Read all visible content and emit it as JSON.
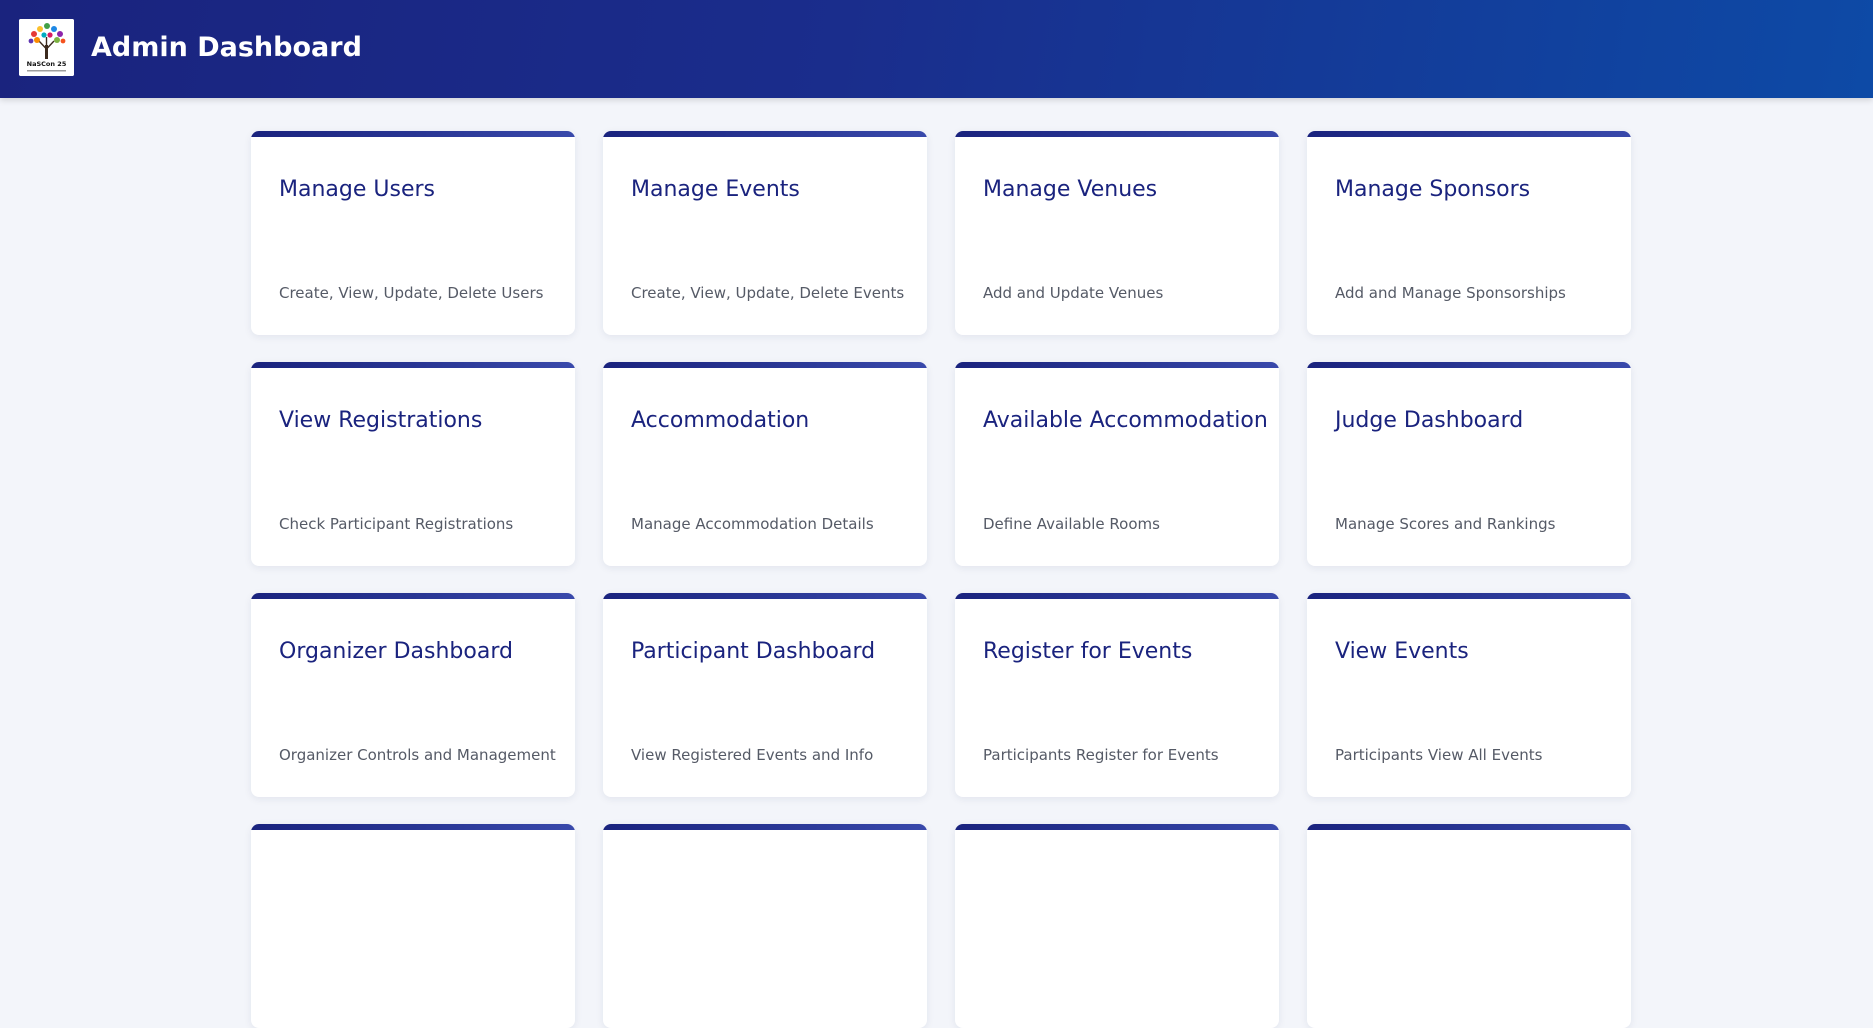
{
  "header": {
    "title": "Admin Dashboard",
    "logo_text": "NaSCon 25"
  },
  "cards": [
    {
      "title": "Manage Users",
      "description": "Create, View, Update, Delete Users"
    },
    {
      "title": "Manage Events",
      "description": "Create, View, Update, Delete Events"
    },
    {
      "title": "Manage Venues",
      "description": "Add and Update Venues"
    },
    {
      "title": "Manage Sponsors",
      "description": "Add and Manage Sponsorships"
    },
    {
      "title": "View Registrations",
      "description": "Check Participant Registrations"
    },
    {
      "title": "Accommodation",
      "description": "Manage Accommodation Details"
    },
    {
      "title": "Available Accommodation",
      "description": "Define Available Rooms"
    },
    {
      "title": "Judge Dashboard",
      "description": "Manage Scores and Rankings"
    },
    {
      "title": "Organizer Dashboard",
      "description": "Organizer Controls and Management"
    },
    {
      "title": "Participant Dashboard",
      "description": "View Registered Events and Info"
    },
    {
      "title": "Register for Events",
      "description": "Participants Register for Events"
    },
    {
      "title": "View Events",
      "description": "Participants View All Events"
    },
    {
      "title": "",
      "description": ""
    },
    {
      "title": "",
      "description": ""
    },
    {
      "title": "",
      "description": ""
    },
    {
      "title": "",
      "description": ""
    }
  ],
  "colors": {
    "header_start": "#1a237e",
    "header_end": "#0d4aa6",
    "card_title": "#1a237e",
    "card_accent": "#283593",
    "background": "#f3f5fa"
  }
}
